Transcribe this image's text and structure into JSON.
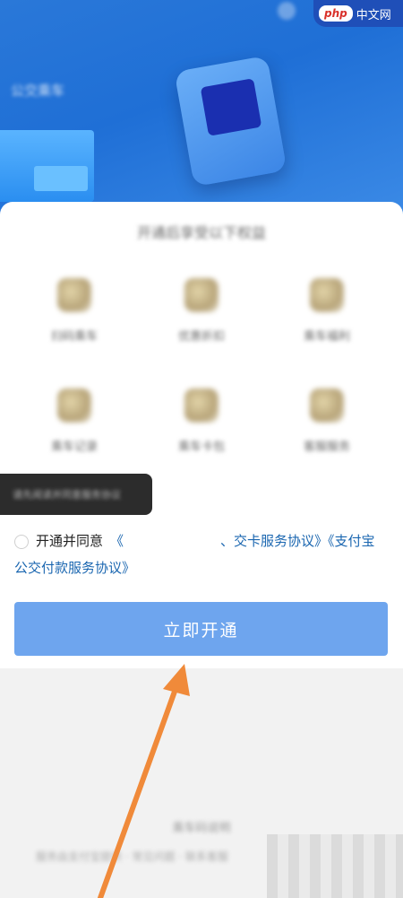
{
  "hero": {
    "label": "公交乘车",
    "watermark_badge": "php",
    "watermark_text": "中文网"
  },
  "card": {
    "title": "开通后享受以下权益",
    "features": [
      {
        "icon": "bus-card-icon",
        "label": "扫码乘车"
      },
      {
        "icon": "coin-icon",
        "label": "优惠折扣"
      },
      {
        "icon": "gift-icon",
        "label": "乘车福利"
      },
      {
        "icon": "ticket-icon",
        "label": "乘车记录"
      },
      {
        "icon": "wallet-icon",
        "label": "乘车卡包"
      },
      {
        "icon": "service-icon",
        "label": "客服服务"
      }
    ]
  },
  "tooltip": {
    "text": "请先阅读并同意服务协议"
  },
  "agreement": {
    "prefix": "开通并同意",
    "link1_start": "《",
    "link1_end": "、交卡服务协议》",
    "link1_tail": "《支付宝",
    "link2": "公交付款服务协议》"
  },
  "cta": {
    "label": "立即开通"
  },
  "footer": {
    "line1": "乘车码说明",
    "line2": "服务由支付宝提供 · 常见问题 · 联系客服"
  },
  "colors": {
    "accent": "#6ea5ee",
    "link": "#1a66b0",
    "hero": "#1f6fd6",
    "annotation_arrow": "#f08a3a"
  }
}
